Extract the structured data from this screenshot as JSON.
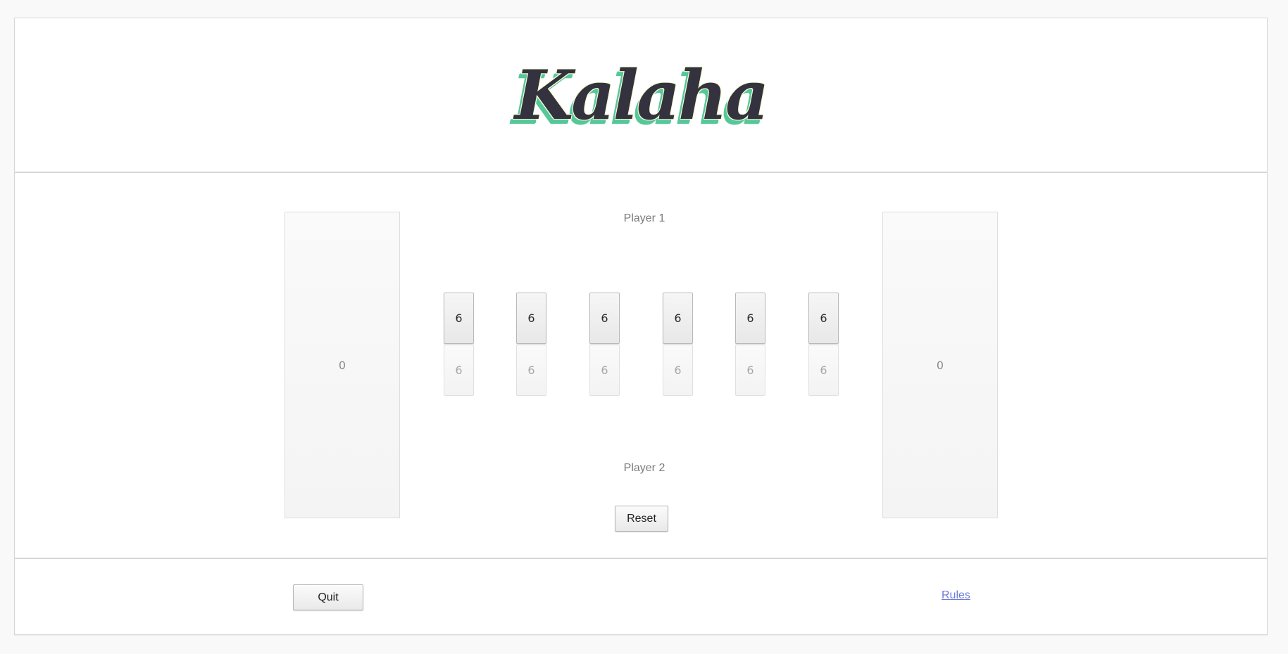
{
  "header": {
    "logo_text": "Kalaha",
    "colors": {
      "logo_fill": "#34323f",
      "logo_shadow": "#56c79a",
      "logo_outline": "#f4ffd2"
    }
  },
  "board": {
    "player1_label": "Player 1",
    "player2_label": "Player 2",
    "left_store": "0",
    "right_store": "0",
    "player1_pits": [
      "6",
      "6",
      "6",
      "6",
      "6",
      "6"
    ],
    "player2_pits": [
      "6",
      "6",
      "6",
      "6",
      "6",
      "6"
    ],
    "reset_label": "Reset"
  },
  "footer": {
    "quit_label": "Quit",
    "rules_label": "Rules"
  }
}
